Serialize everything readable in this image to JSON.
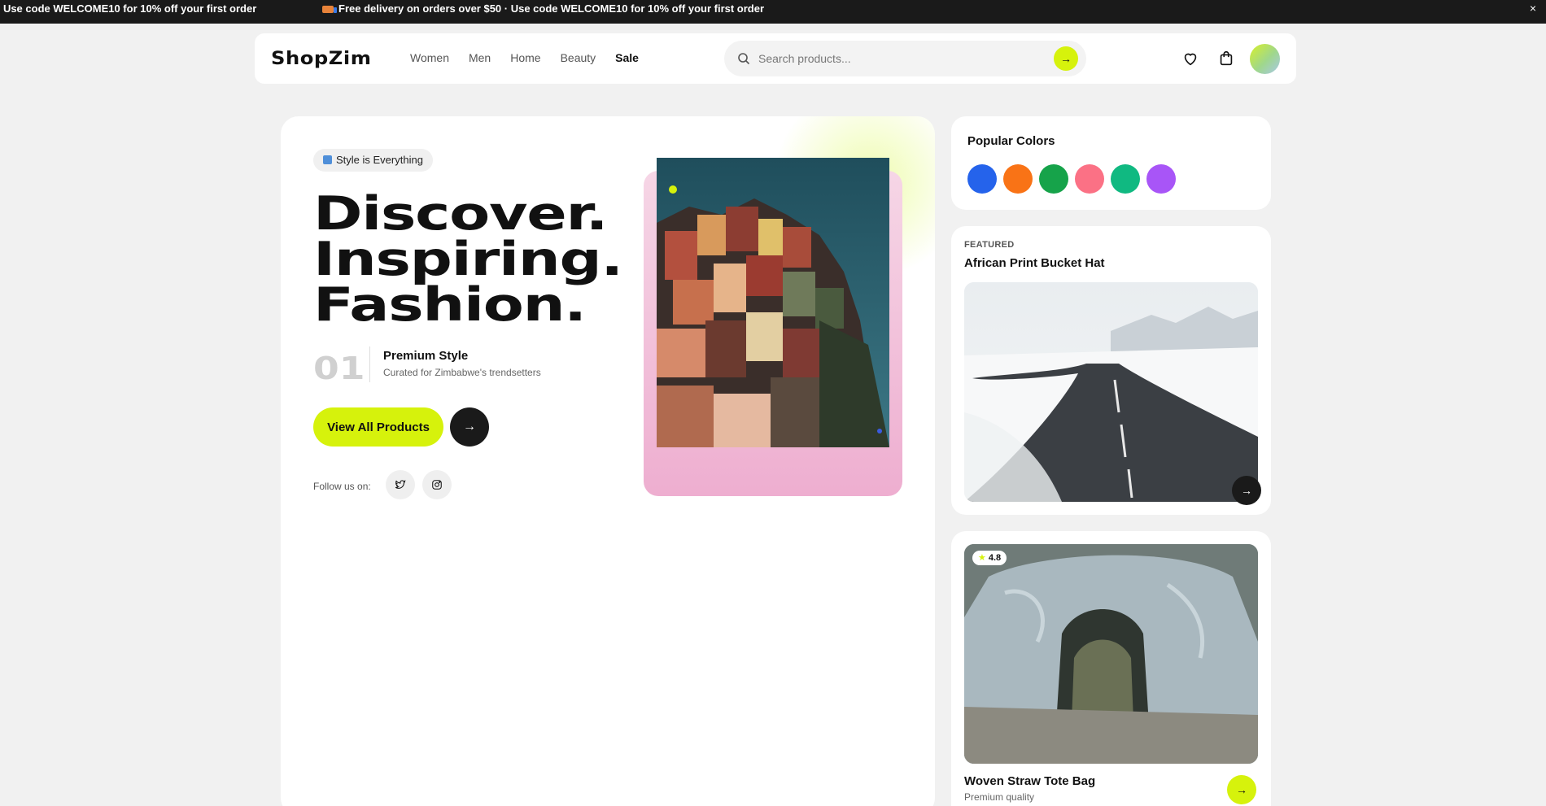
{
  "announcement": {
    "message_1": "- Use code WELCOME10 for 10% off your first order",
    "message_2": "Free delivery on orders over $50 · Use code WELCOME10 for 10% off your first order",
    "close_label": "×"
  },
  "nav": {
    "logo": "ShopZim",
    "links": [
      "Women",
      "Men",
      "Home",
      "Beauty",
      "Sale"
    ],
    "search_placeholder": "Search products...",
    "search_button": "→"
  },
  "hero": {
    "tagline": "Style is Everything",
    "headline_lines": [
      "Discover.",
      "Inspiring.",
      "Fashion."
    ],
    "step_number": "01",
    "step_title": "Premium Style",
    "step_subtitle": "Curated for Zimbabwe's trendsetters",
    "cta_label": "View All Products",
    "cta_arrow": "→",
    "follow_label": "Follow us on:"
  },
  "popular_colors": {
    "title": "Popular Colors",
    "swatches": [
      "#2563eb",
      "#f97316",
      "#16a34a",
      "#fb7185",
      "#10b981",
      "#a855f7"
    ]
  },
  "featured": {
    "label": "FEATURED",
    "title": "African Print Bucket Hat",
    "arrow": "→"
  },
  "product": {
    "rating": "4.8",
    "title": "Woven Straw Tote Bag",
    "subtitle": "Premium quality",
    "arrow": "→"
  },
  "colors": {
    "accent": "#d6f20c",
    "dark": "#1a1a1a",
    "background": "#f1f1f1"
  }
}
